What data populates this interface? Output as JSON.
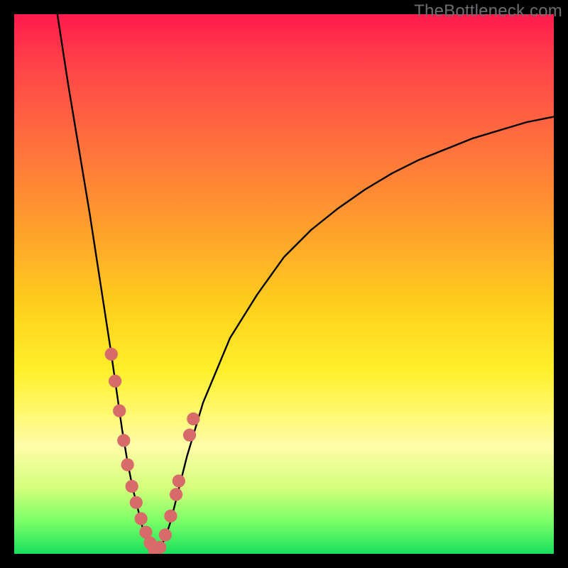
{
  "watermark": "TheBottleneck.com",
  "chart_data": {
    "type": "line",
    "title": "",
    "xlabel": "",
    "ylabel": "",
    "xlim": [
      0,
      100
    ],
    "ylim": [
      0,
      100
    ],
    "left_curve": {
      "name": "left-branch",
      "x": [
        8,
        10,
        12,
        14,
        16,
        18,
        19,
        20,
        21,
        22,
        23,
        24,
        25,
        26
      ],
      "y": [
        100,
        87,
        75,
        63,
        50,
        37,
        30,
        23,
        17,
        12,
        8,
        4,
        1,
        0
      ]
    },
    "right_curve": {
      "name": "right-branch",
      "x": [
        26,
        27,
        28,
        29,
        30,
        32,
        35,
        40,
        45,
        50,
        55,
        60,
        65,
        70,
        75,
        80,
        85,
        90,
        95,
        100
      ],
      "y": [
        0,
        1,
        3,
        6,
        10,
        18,
        28,
        40,
        48,
        55,
        60,
        64,
        67.5,
        70.5,
        73,
        75,
        77,
        78.5,
        80,
        81
      ]
    },
    "markers": {
      "name": "data-points",
      "x": [
        18.0,
        18.7,
        19.5,
        20.3,
        21.0,
        21.8,
        22.6,
        23.5,
        24.4,
        25.2,
        26.0,
        27.0,
        28.0,
        29.0,
        30.0,
        30.5,
        32.5,
        33.2
      ],
      "y": [
        37.0,
        32.0,
        26.5,
        21.0,
        16.5,
        12.5,
        9.5,
        6.5,
        4.0,
        2.0,
        0.6,
        1.2,
        3.5,
        7.0,
        11.0,
        13.5,
        22.0,
        25.0
      ]
    },
    "marker_radius_pct": 1.2,
    "gradient_stops": [
      {
        "pos": 0.0,
        "color": "#ff1a4d"
      },
      {
        "pos": 0.08,
        "color": "#ff3e4a"
      },
      {
        "pos": 0.22,
        "color": "#ff6a3f"
      },
      {
        "pos": 0.38,
        "color": "#ff9a2e"
      },
      {
        "pos": 0.55,
        "color": "#ffd21c"
      },
      {
        "pos": 0.66,
        "color": "#ffef2a"
      },
      {
        "pos": 0.74,
        "color": "#fff870"
      },
      {
        "pos": 0.8,
        "color": "#fffca8"
      },
      {
        "pos": 0.88,
        "color": "#d2ff7a"
      },
      {
        "pos": 0.94,
        "color": "#7aff66"
      },
      {
        "pos": 1.0,
        "color": "#18e05c"
      }
    ]
  }
}
